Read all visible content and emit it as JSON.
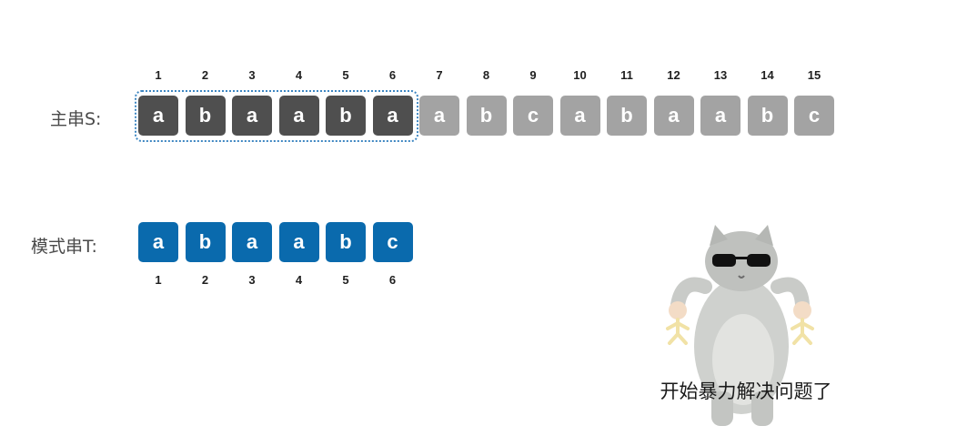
{
  "main_string": {
    "label": "主串S:",
    "indices": [
      "1",
      "2",
      "3",
      "4",
      "5",
      "6",
      "7",
      "8",
      "9",
      "10",
      "11",
      "12",
      "13",
      "14",
      "15"
    ],
    "chars": [
      "a",
      "b",
      "a",
      "a",
      "b",
      "a",
      "a",
      "b",
      "c",
      "a",
      "b",
      "a",
      "a",
      "b",
      "c"
    ],
    "highlight_count": 6,
    "colors": {
      "compared": "#4f4f4f",
      "pending": "#a3a3a3",
      "window_border": "#3f87c2"
    }
  },
  "pattern_string": {
    "label": "模式串T:",
    "indices": [
      "1",
      "2",
      "3",
      "4",
      "5",
      "6"
    ],
    "chars": [
      "a",
      "b",
      "a",
      "a",
      "b",
      "c"
    ],
    "color": "#0a6aad"
  },
  "meme": {
    "icon": "cat-with-sunglasses-holding-figures-icon",
    "caption": "开始暴力解决问题了"
  }
}
